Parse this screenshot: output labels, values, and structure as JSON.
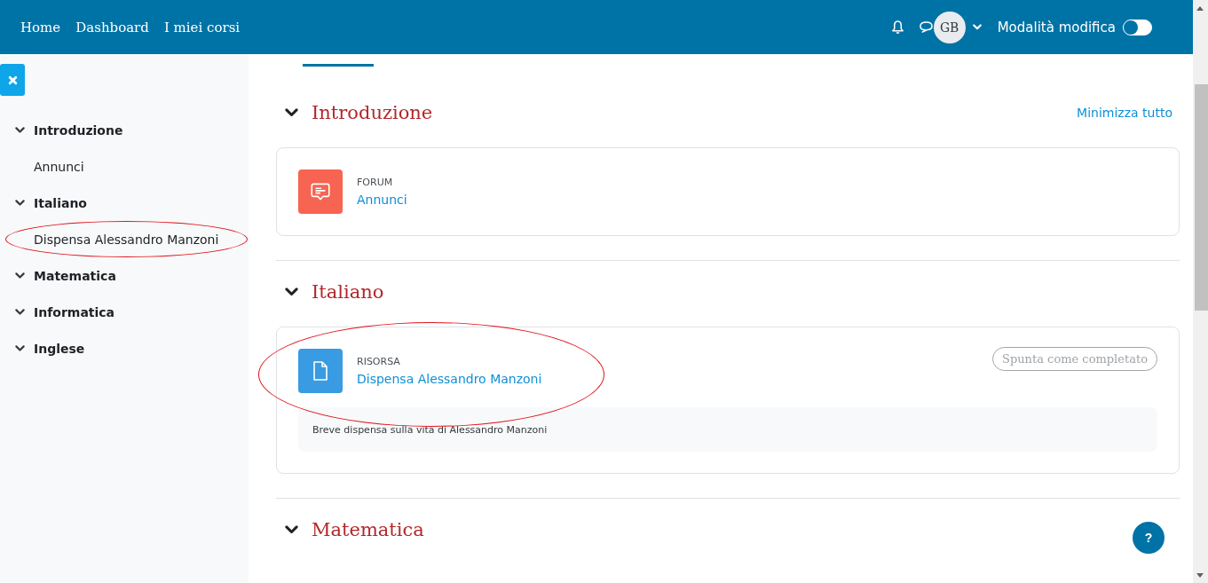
{
  "header": {
    "nav": [
      {
        "label": "Home"
      },
      {
        "label": "Dashboard"
      },
      {
        "label": "I miei corsi"
      }
    ],
    "avatar": "GB",
    "edit_mode": {
      "label": "Modalità modifica",
      "on": false
    }
  },
  "sidebar": {
    "sections": [
      {
        "title": "Introduzione",
        "expanded": true,
        "children": [
          {
            "label": "Annunci",
            "circled": false
          }
        ]
      },
      {
        "title": "Italiano",
        "expanded": true,
        "children": [
          {
            "label": "Dispensa Alessandro Manzoni",
            "circled": true
          }
        ]
      },
      {
        "title": "Matematica",
        "expanded": true
      },
      {
        "title": "Informatica",
        "expanded": true
      },
      {
        "title": "Inglese",
        "expanded": true
      }
    ]
  },
  "course": {
    "collapse_all": "Minimizza tutto",
    "sections": [
      {
        "title": "Introduzione",
        "expanded": true,
        "activities": [
          {
            "kind": "forum",
            "type_label": "FORUM",
            "name": "Annunci",
            "circled": false
          }
        ]
      },
      {
        "title": "Italiano",
        "expanded": true,
        "activities": [
          {
            "kind": "resource",
            "type_label": "RISORSA",
            "name": "Dispensa Alessandro Manzoni",
            "completion": "Spunta come completato",
            "description": "Breve dispensa sulla vita di Alessandro Manzoni",
            "circled": true
          }
        ]
      },
      {
        "title": "Matematica",
        "expanded": true
      }
    ]
  },
  "help_button": "?"
}
